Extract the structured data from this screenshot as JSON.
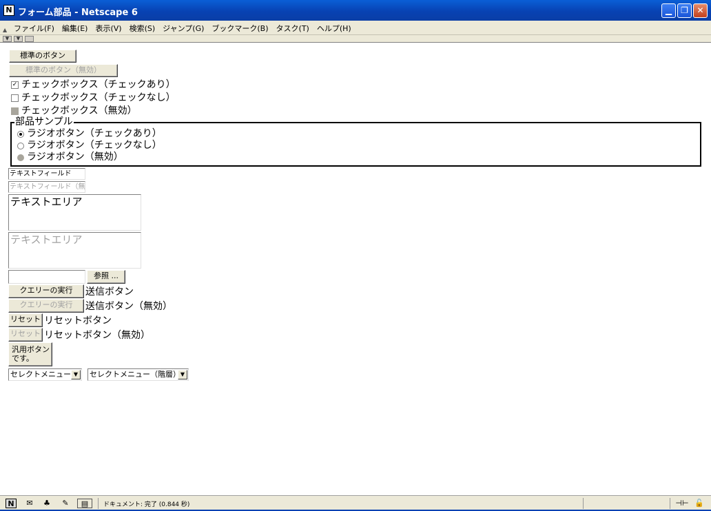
{
  "window": {
    "title": "フォーム部品 - Netscape 6",
    "app_icon_letter": "N"
  },
  "menu": {
    "items": [
      "ファイル(F)",
      "編集(E)",
      "表示(V)",
      "検索(S)",
      "ジャンプ(G)",
      "ブックマーク(B)",
      "タスク(T)",
      "ヘルプ(H)"
    ]
  },
  "form": {
    "button_standard": "標準のボタン",
    "button_standard_disabled": "標準のボタン（無効）",
    "checkbox_checked": "チェックボックス（チェックあり）",
    "checkbox_unchecked": "チェックボックス（チェックなし）",
    "checkbox_disabled": "チェックボックス（無効）",
    "fieldset_legend": "部品サンプル",
    "radio_checked": "ラジオボタン（チェックあり）",
    "radio_unchecked": "ラジオボタン（チェックなし）",
    "radio_disabled": "ラジオボタン（無効）",
    "text_field": "テキストフィールド",
    "text_field_disabled": "テキストフィールド（無効）",
    "text_area": "テキストエリア",
    "text_area_disabled": "テキストエリア",
    "browse_button": "参照 ...",
    "submit_button": "クエリーの実行",
    "submit_label": "送信ボタン",
    "submit_button_disabled": "クエリーの実行",
    "submit_label_disabled": "送信ボタン（無効）",
    "reset_button": "リセット",
    "reset_label": "リセットボタン",
    "reset_button_disabled": "リセット",
    "reset_label_disabled": "リセットボタン（無効）",
    "generic_button_line1": "汎用ボタン",
    "generic_button_line2": "です。",
    "select_menu": "セレクトメニュー",
    "select_menu_hierarchy": "セレクトメニュー（階層）"
  },
  "status": {
    "text": "ドキュメント: 完了 (0.844 秒)"
  }
}
